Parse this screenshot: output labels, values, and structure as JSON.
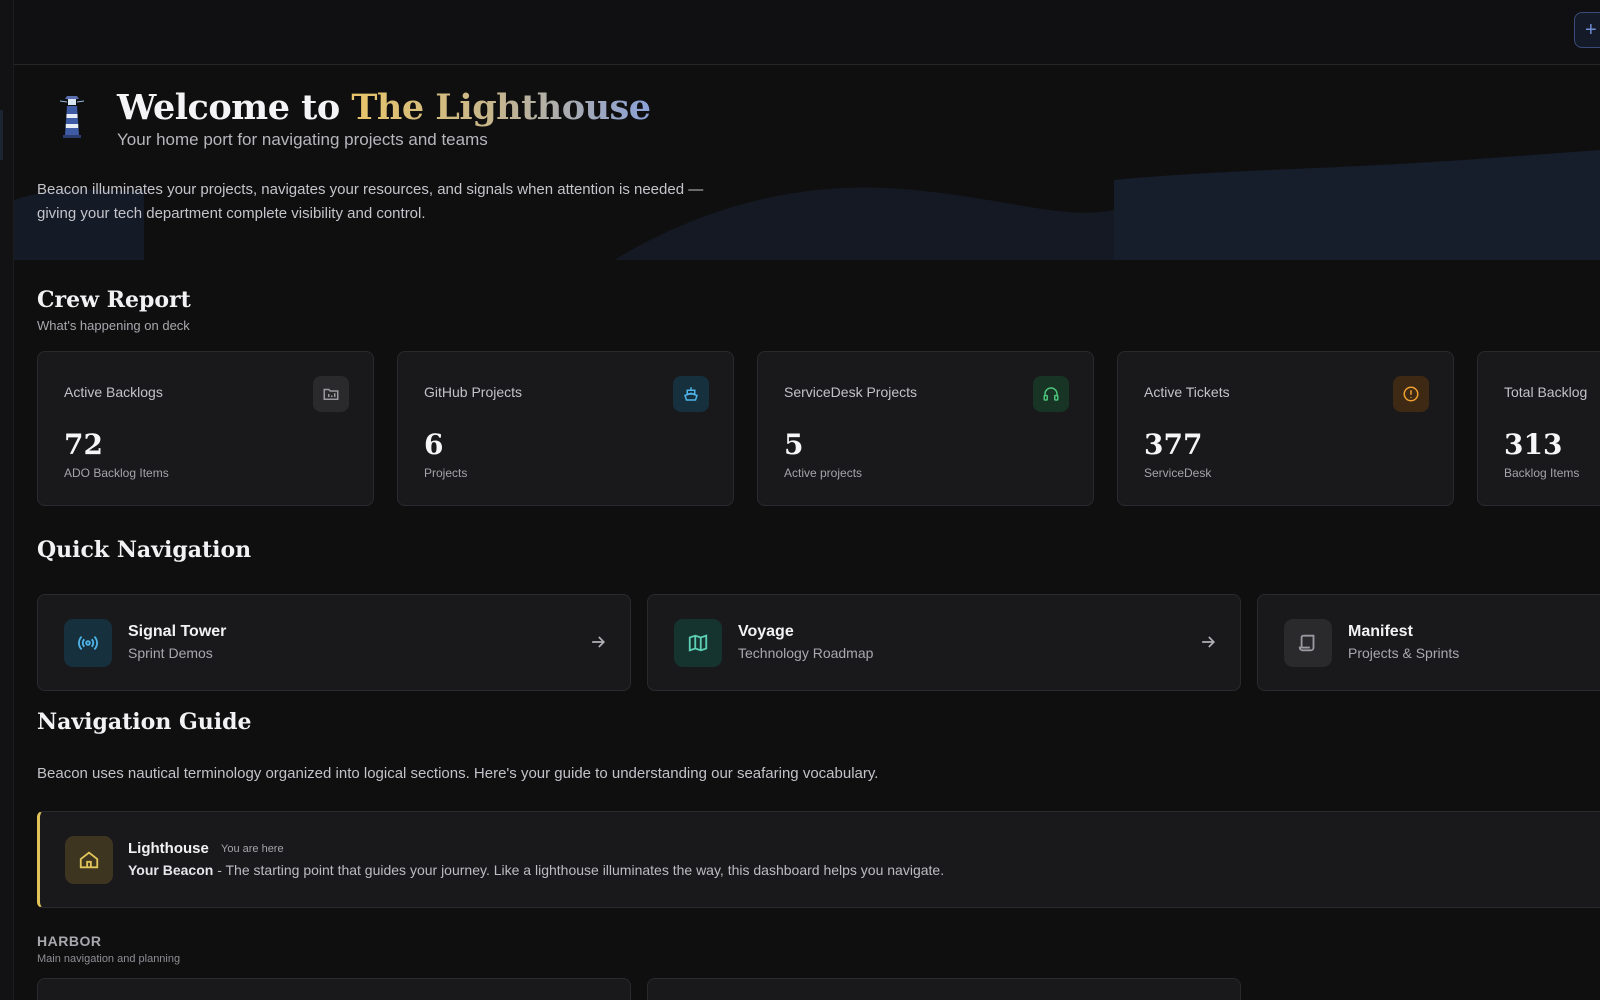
{
  "colors": {
    "background": "#0f0f10",
    "card": "#19191b",
    "accent_gold": "#e2c45a",
    "accent_blue": "#6e8fd6"
  },
  "topbar": {
    "action_icon": "plus-icon",
    "action_glyph": "+"
  },
  "hero": {
    "title_prefix": "Welcome to",
    "title_accent": "The Lighthouse",
    "subtitle": "Your home port for navigating projects and teams",
    "description": "Beacon illuminates your projects, navigates your resources, and signals when attention is needed — giving your tech department complete visibility and control.",
    "icon": "lighthouse-icon"
  },
  "crew_report": {
    "title": "Crew Report",
    "subtitle": "What's happening on deck",
    "stats": [
      {
        "label": "Active Backlogs",
        "value": "72",
        "caption": "ADO Backlog Items",
        "icon": "folder-icon",
        "color": "#9a9aa0"
      },
      {
        "label": "GitHub Projects",
        "value": "6",
        "caption": "Projects",
        "icon": "ship-icon",
        "color": "#4fb3e8"
      },
      {
        "label": "ServiceDesk Projects",
        "value": "5",
        "caption": "Active projects",
        "icon": "headphones-icon",
        "color": "#4cc27a"
      },
      {
        "label": "Active Tickets",
        "value": "377",
        "caption": "ServiceDesk",
        "icon": "alert-circle-icon",
        "color": "#f0a030"
      },
      {
        "label": "Total Backlog",
        "value": "313",
        "caption": "Backlog Items",
        "icon": "list-icon",
        "color": "#9a9aa0"
      }
    ]
  },
  "quick_navigation": {
    "title": "Quick Navigation",
    "items": [
      {
        "title": "Signal Tower",
        "subtitle": "Sprint Demos",
        "icon": "broadcast-icon",
        "color": "#4fb3e8"
      },
      {
        "title": "Voyage",
        "subtitle": "Technology Roadmap",
        "icon": "map-icon",
        "color": "#5ccfb4"
      },
      {
        "title": "Manifest",
        "subtitle": "Projects & Sprints",
        "icon": "scroll-icon",
        "color": "#9a9aa0"
      }
    ]
  },
  "navigation_guide": {
    "title": "Navigation Guide",
    "description": "Beacon uses nautical terminology organized into logical sections. Here's your guide to understanding our seafaring vocabulary.",
    "current": {
      "title": "Lighthouse",
      "badge": "You are here",
      "desc_bold": "Your Beacon",
      "desc_rest": " - The starting point that guides your journey. Like a lighthouse illuminates the way, this dashboard helps you navigate.",
      "icon": "home-icon"
    },
    "harbor": {
      "title": "HARBOR",
      "subtitle": "Main navigation and planning"
    }
  }
}
